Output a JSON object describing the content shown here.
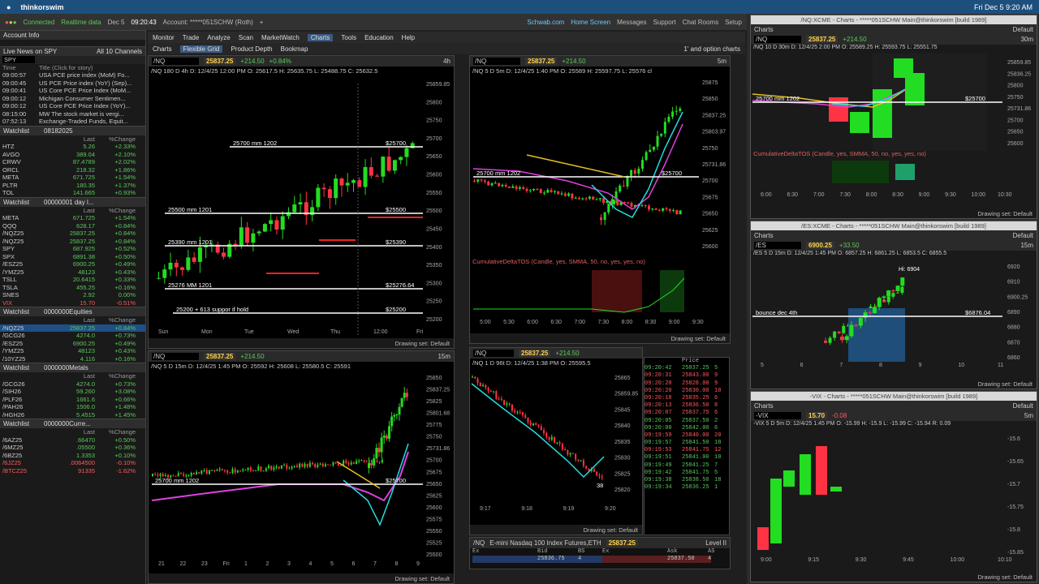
{
  "mac": {
    "app": "thinkorswim",
    "clock": "Fri Dec 5  9:20 AM"
  },
  "status": {
    "connected": "Connected",
    "realtime": "Realtime data",
    "date": "Dec 5",
    "time": "09:20:43",
    "account": "Account: *****051SCHW (Roth)"
  },
  "links": {
    "schwab": "Schwab.com",
    "home": "Home Screen",
    "messages": "Messages",
    "support": "Support",
    "chat": "Chat Rooms",
    "setup": "Setup",
    "ondemand": "OnDemand"
  },
  "menu": [
    "Monitor",
    "Trade",
    "Analyze",
    "Scan",
    "MarketWatch",
    "Charts",
    "Tools",
    "Education",
    "Help"
  ],
  "subtabs": [
    "Charts",
    "Flexible Grid",
    "Product Depth",
    "Bookmap"
  ],
  "subtab_right": "1' and option charts",
  "acct_info": "Account Info",
  "news": {
    "title": "Live News on SPY",
    "channels": "All 10 Channels",
    "symbol": "SPY",
    "cols": [
      "Time",
      "Title (Click for story)"
    ],
    "items": [
      [
        "09:00:57",
        "USA PCE price index (MoM) Fo..."
      ],
      [
        "09:00:45",
        "US PCE Price index (YoY) (Sep)..."
      ],
      [
        "09:00:41",
        "US Core PCE Price Index (MoM..."
      ],
      [
        "09:00:12",
        "Michigan Consumer Sentimen..."
      ],
      [
        "09:00:12",
        "US Core PCE Price Index (YoY)..."
      ],
      [
        "08:15:00",
        "MW The stock market is vergi..."
      ],
      [
        "07:52:13",
        "Exchange-Traded Funds, Equit..."
      ]
    ]
  },
  "watchlists": [
    {
      "name": "Watchlist",
      "id": "08182025",
      "cols": [
        "",
        "Last",
        "%Change"
      ],
      "rows": [
        [
          "HTZ",
          "5.26",
          "+2.33%"
        ],
        [
          "AVGO",
          "389.04",
          "+2.10%"
        ],
        [
          "CRWV",
          "87.4789",
          "+2.02%"
        ],
        [
          "ORCL",
          "218.32",
          "+1.86%"
        ],
        [
          "META",
          "671.725",
          "+1.54%"
        ],
        [
          "PLTR",
          "180.35",
          "+1.37%"
        ],
        [
          "TOL",
          "141.665",
          "+0.93%"
        ]
      ]
    },
    {
      "name": "Watchlist",
      "id": "00000001 day l...",
      "cols": [
        "",
        "Last",
        "%Change"
      ],
      "rows": [
        [
          "META",
          "671.725",
          "+1.54%"
        ],
        [
          "QQQ",
          "628.17",
          "+0.84%"
        ],
        [
          "/NQZ25",
          "25837.25",
          "+0.84%"
        ],
        [
          "/NQZ25",
          "25837.25",
          "+0.84%"
        ],
        [
          "SPY",
          "687.925",
          "+0.52%"
        ],
        [
          "SPX",
          "6891.38",
          "+0.50%"
        ],
        [
          "/ESZ25",
          "6900.25",
          "+0.49%"
        ],
        [
          "/YMZ25",
          "48123",
          "+0.43%"
        ],
        [
          "TSLL",
          "20.6415",
          "+0.33%"
        ],
        [
          "TSLA",
          "455.25",
          "+0.16%"
        ],
        [
          "SNES",
          "2.92",
          "0.00%"
        ],
        [
          "VIX",
          "15.70",
          "-0.51%"
        ]
      ]
    },
    {
      "name": "Watchlist",
      "id": "0000000Equities",
      "cols": [
        "",
        "Last",
        "%Change"
      ],
      "rows": [
        [
          "/NQZ25",
          "25837.25",
          "+0.84%"
        ],
        [
          "/GCG26",
          "4274.0",
          "+0.73%"
        ],
        [
          "/ESZ25",
          "6900.25",
          "+0.49%"
        ],
        [
          "/YMZ25",
          "48123",
          "+0.43%"
        ],
        [
          "/10YZ25",
          "4.116",
          "+0.16%"
        ]
      ]
    },
    {
      "name": "Watchlist",
      "id": "0000000Metals",
      "cols": [
        "",
        "Last",
        "%Change"
      ],
      "rows": [
        [
          "/GCG26",
          "4274.0",
          "+0.73%"
        ],
        [
          "/SIH26",
          "59.260",
          "+3.08%"
        ],
        [
          "/PLF26",
          "1661.6",
          "+0.66%"
        ],
        [
          "/PAH26",
          "1506.0",
          "+1.48%"
        ],
        [
          "/HGH26",
          "5.4515",
          "+1.45%"
        ]
      ]
    },
    {
      "name": "Watchlist",
      "id": "0000000Curre...",
      "cols": [
        "",
        "Last",
        "%Change"
      ],
      "rows": [
        [
          "/6AZ25",
          ".66470",
          "+0.50%"
        ],
        [
          "/6MZ25",
          ".05500",
          "+0.36%"
        ],
        [
          "/6BZ25",
          "1.3353",
          "+0.10%"
        ],
        [
          "/6JZ25",
          ".0064500",
          "-0.10%"
        ],
        [
          "/BTCZ25",
          "91335",
          "-1.62%"
        ]
      ]
    }
  ],
  "charts": {
    "c1": {
      "sym": "/NQ",
      "tf": "4h",
      "price": "25837.25",
      "chg": "+214.50",
      "pct": "+0.84%",
      "bid": "B: 25837.25",
      "ask": "A: 25837.5",
      "sub": "/NQ 180 D 4h  D: 12/4/25 12:00 PM  O: 25617.5  H: 25635.75  L: 25488.75  C: 25632.5",
      "levels": [
        "25700 mm 1202",
        "25500 mm 1201",
        "25390 mm 1201",
        "25276 MM 1201",
        "25200 + 613 suppor if hold"
      ],
      "rlabels": [
        "$25700",
        "$25500",
        "$25390",
        "$25276.64",
        "$25200"
      ],
      "yticks": [
        "25859.85",
        "25800",
        "25750",
        "25700",
        "25650",
        "25600",
        "25550",
        "25500",
        "25450",
        "25400",
        "25350",
        "25300",
        "25250",
        "25200"
      ],
      "xticks": [
        "Sun",
        "Mon",
        "Tue",
        "Wed",
        "Thu",
        "12:00",
        "Fri"
      ]
    },
    "c2": {
      "sym": "/NQ",
      "tf": "5m",
      "price": "25837.25",
      "chg": "+214.50",
      "pct": "+0.84%",
      "sub": "/NQ 5 D 5m  D: 12/4/25 1:40 PM  O: 25589  H: 25597.75  L: 25576 cl",
      "level": "25700 mm 1202",
      "rlabel": "$25700",
      "yticks": [
        "25875",
        "25850",
        "25837.25",
        "25803.97",
        "25750",
        "25731.86",
        "25700",
        "25675",
        "25650",
        "25625",
        "25600"
      ],
      "indicator": "CumulativeDeltaTOS (Candle, yes, SMMA, 50, no, yes, yes, no)",
      "na": "N/A",
      "iticks": [
        "80,000",
        "40,000"
      ],
      "ival": "57,047.00",
      "xticks": [
        "5:00",
        "5:30",
        "6:00",
        "6:30",
        "7:00",
        "7:30",
        "8:00",
        "8:30",
        "9:00",
        "9:30"
      ]
    },
    "c3": {
      "sym": "/NQ",
      "tf": "15m",
      "price": "25837.25",
      "chg": "+214.50",
      "pct": "+0.84%",
      "sub": "/NQ 5 D 15m  D: 12/4/25 1:45 PM  O: 25592  H: 25608  L: 25580.5  C: 25591",
      "level": "25700 mm 1202",
      "rlabel": "$25700",
      "yticks": [
        "25850",
        "25837.25",
        "25825",
        "25801.68",
        "25775",
        "25750",
        "25731.86",
        "25700",
        "25675",
        "25650",
        "25625",
        "25600",
        "25575",
        "25550",
        "25525",
        "25500"
      ],
      "xticks": [
        "21",
        "22",
        "23",
        "Fri",
        "1",
        "2",
        "3",
        "4",
        "5",
        "6",
        "7",
        "8",
        "9"
      ]
    },
    "c4": {
      "sym": "/NQ",
      "tf": "5m",
      "price": "25837.25",
      "chg": "+214.50",
      "pct": "+0.84%",
      "sub": "/NQ 1 D 96t  D: 12/4/25 1:38 PM  O: 25595.5",
      "yticks": [
        "25865",
        "25859.85",
        "25845",
        "25840",
        "25835",
        "25830",
        "25825",
        "25820"
      ],
      "xticks": [
        "9:17",
        "9:18",
        "9:19",
        "9:20"
      ],
      "badge": "38"
    },
    "ts": {
      "cols": [
        "",
        "Price",
        ""
      ],
      "rows": [
        [
          "09:20:42",
          "25837.25",
          "5",
          "g"
        ],
        [
          "09:20:31",
          "25843.00",
          "9",
          "r"
        ],
        [
          "09:20:20",
          "25828.00",
          "9",
          "r"
        ],
        [
          "09:20:20",
          "25830.00",
          "10",
          "r"
        ],
        [
          "09:20:18",
          "25835.25",
          "6",
          "r"
        ],
        [
          "09:20:13",
          "25836.50",
          "8",
          "r"
        ],
        [
          "09:20:07",
          "25837.75",
          "6",
          "r"
        ],
        [
          "09:20:05",
          "25837.50",
          "2",
          "g"
        ],
        [
          "09:20:00",
          "25842.00",
          "6",
          "g"
        ],
        [
          "09:19:59",
          "25840.00",
          "20",
          "r"
        ],
        [
          "09:19:57",
          "25841.50",
          "18",
          "g"
        ],
        [
          "09:19:53",
          "25841.75",
          "12",
          "r"
        ],
        [
          "09:19:51",
          "25841.00",
          "10",
          "g"
        ],
        [
          "09:19:49",
          "25841.25",
          "7",
          "g"
        ],
        [
          "09:19:42",
          "25841.75",
          "5",
          "g"
        ],
        [
          "09:19:38",
          "25838.50",
          "18",
          "g"
        ],
        [
          "09:19:34",
          "25836.25",
          "1",
          "g"
        ]
      ]
    },
    "l2": {
      "sym": "/NQ",
      "desc": "E-mini Nasdaq 100 Index Futures,ETH",
      "price": "25837.25",
      "lvl": "Level II",
      "cols": [
        "Ex",
        "Bid",
        "BS",
        "Ex",
        "Ask",
        "AS"
      ],
      "bid": "25836.75",
      "bs": "4",
      "ask": "25837.50",
      "as": "4"
    }
  },
  "right": {
    "nq": {
      "title": "/NQ:XCME - Charts - *****051SCHW Main@thinkorswim [build 1989]",
      "sym": "/NQ",
      "price": "25837.25",
      "chg": "+214.50",
      "pct": "+0.84%",
      "tf": "30m",
      "sub": "/NQ 10 D 30m  D: 12/4/25 2:00 PM  O: 25589.25  H: 25593.75  L: 25551.75",
      "level": "25700 mm 1202",
      "rlabel": "$25700",
      "yticks": [
        "25859.85",
        "25836.25",
        "25800",
        "25750",
        "25731.86",
        "25700",
        "25650",
        "25600"
      ],
      "indicator": "CumulativeDeltaTOS (Candle, yes, SMMA, 50, no, yes, yes, no)",
      "xticks": [
        "6:00",
        "6:30",
        "7:00",
        "7:30",
        "8:00",
        "8:30",
        "9:00",
        "9:30",
        "10:00",
        "10:30"
      ]
    },
    "es": {
      "title": "/ES:XCME - Charts - *****051SCHW Main@thinkorswim [build 1989]",
      "sym": "/ES",
      "price": "6900.25",
      "chg": "+33.50",
      "pct": "+0.49%",
      "tf": "15m",
      "sub": "/ES 5 D 15m  D: 12/4/25 1:45 PM  O: 6857.25  H: 6861.25  L: 6853.5  C: 6855.5",
      "hi": "Hi: 6904",
      "level": "bounce dec 4th",
      "rlabel": "$6876.04",
      "yticks": [
        "6920",
        "6910",
        "6900.25",
        "6890",
        "6880",
        "6870",
        "6860"
      ],
      "xticks": [
        "5",
        "6",
        "7",
        "8",
        "9",
        "10",
        "11"
      ]
    },
    "vix": {
      "title": "-VIX - Charts - *****051SCHW Main@thinkorswim [build 1989]",
      "sym": "-VIX",
      "price": "15.70",
      "chg": "-0.08",
      "pct": "-0.51%",
      "tf": "5m",
      "sub": "-VIX 5 D 5m  D: 12/4/25 1:45 PM  O: -15.99  H: -15.9  L: -15.99  C: -15.94  R: 0.09",
      "yticks": [
        "-15.6",
        "-15.65",
        "-15.7",
        "-15.75",
        "-15.8",
        "-15.85"
      ],
      "xticks": [
        "9:00",
        "9:15",
        "9:30",
        "9:45",
        "10:00",
        "10:10"
      ]
    },
    "drawing": "Drawing set: Default",
    "charts_label": "Charts",
    "default": "Default"
  }
}
